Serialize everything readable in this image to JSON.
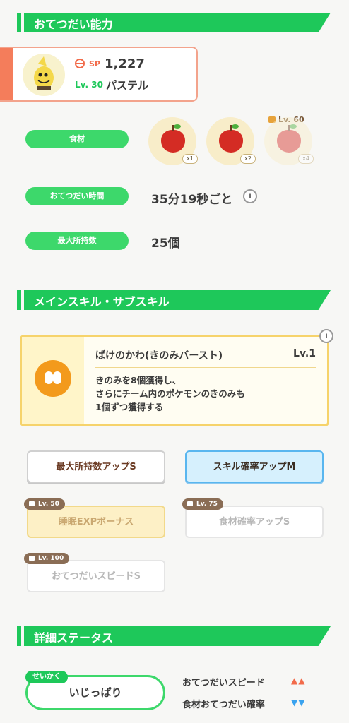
{
  "sections": {
    "help_ability": "おてつだい能力",
    "skills": "メインスキル・サブスキル",
    "detail_status": "詳細ステータス"
  },
  "pokemon": {
    "sp_label": "SP",
    "sp_value": "1,227",
    "level": "Lv. 30",
    "name": "パステル"
  },
  "stats": {
    "ingredients_label": "食材",
    "help_time_label": "おてつだい時間",
    "help_time_value": "35分19秒ごと",
    "max_carry_label": "最大所持数",
    "max_carry_value": "25個",
    "info_icon": "i"
  },
  "ingredients": [
    {
      "qty": "x1",
      "icon": "apple-icon",
      "locked": false
    },
    {
      "qty": "x2",
      "icon": "apple-icon",
      "locked": false
    },
    {
      "qty": "x4",
      "icon": "apple-icon",
      "locked": true,
      "unlock_level": "Lv. 60"
    }
  ],
  "main_skill": {
    "name": "ばけのかわ(きのみバースト)",
    "level": "Lv.1",
    "desc_line1": "きのみを8個獲得し、",
    "desc_line2": "さらにチーム内のポケモンのきのみも",
    "desc_line3": "1個ずつ獲得する",
    "info_icon": "i"
  },
  "sub_skills": [
    {
      "label": "最大所持数アップS",
      "locked": false
    },
    {
      "label": "スキル確率アップM",
      "locked": false
    },
    {
      "label": "睡眠EXPボーナス",
      "locked": true,
      "unlock_level": "Lv. 50"
    },
    {
      "label": "食材確率アップS",
      "locked": true,
      "unlock_level": "Lv. 75"
    },
    {
      "label": "おてつだいスピードS",
      "locked": true,
      "unlock_level": "Lv. 100"
    }
  ],
  "nature": {
    "tag": "せいかく",
    "name": "いじっぱり",
    "up_stat": "おてつだいスピード",
    "up_arrows": "▲▲",
    "down_stat": "食材おてつだい確率",
    "down_arrows": "▼▼",
    "up_color": "#f26b4a",
    "down_color": "#3aa3ef"
  }
}
